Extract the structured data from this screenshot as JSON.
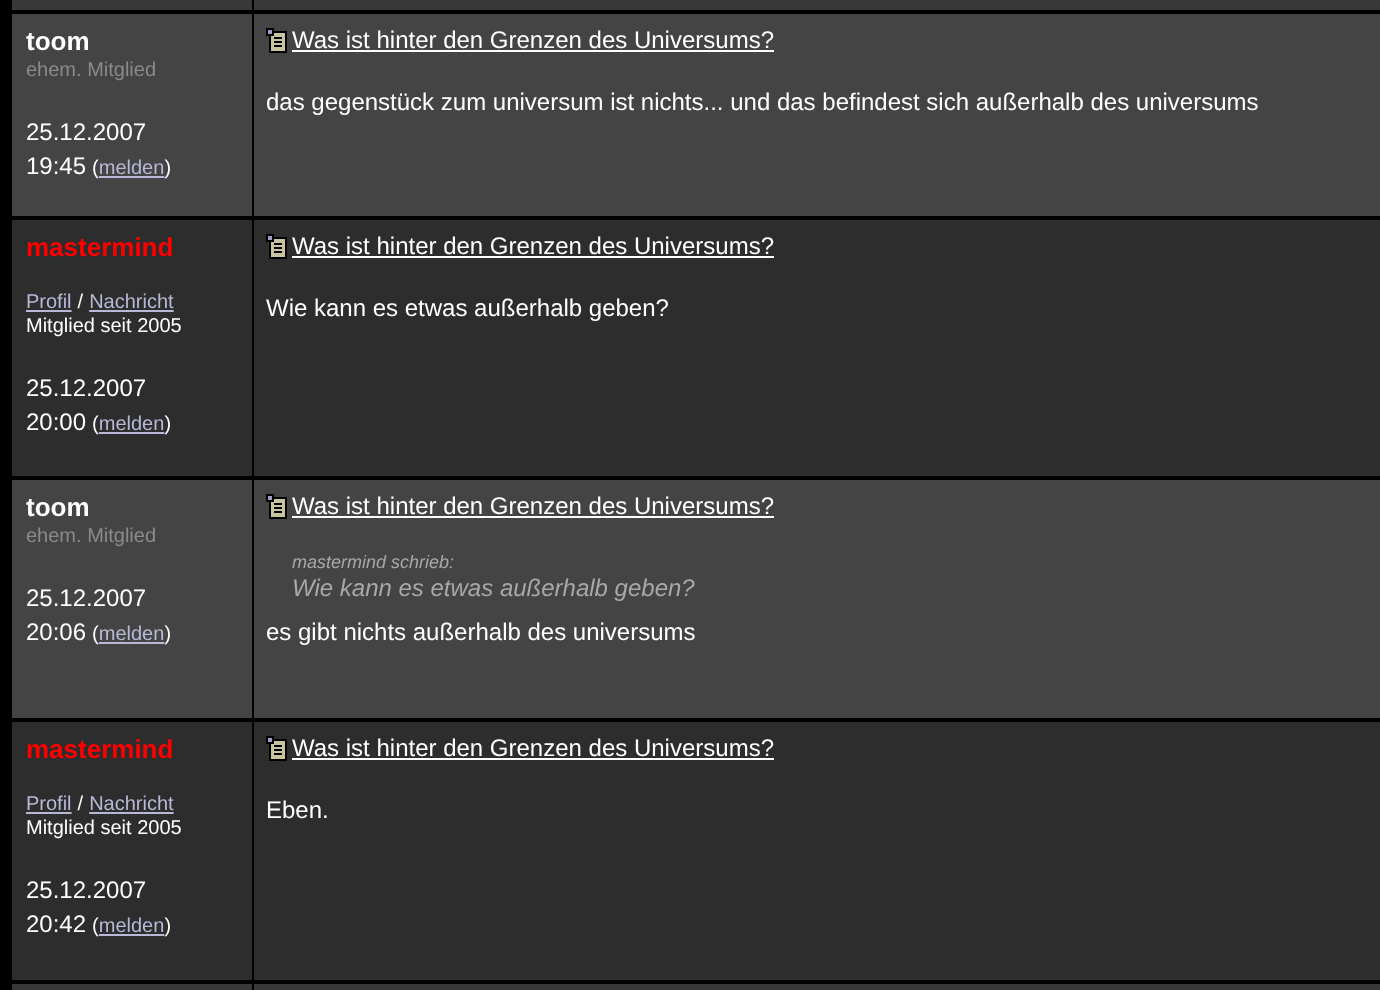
{
  "posts": [
    {
      "author": "toom",
      "kind": "former",
      "role": "ehem. Mitglied",
      "date": "25.12.2007",
      "time": "19:45",
      "report": [
        "(",
        "melden",
        ")"
      ],
      "subject": "Was ist hinter den Grenzen des Universums?",
      "body": "das gegenstück zum universum ist nichts... und das befindest sich außerhalb des universums"
    },
    {
      "author": "mastermind",
      "kind": "member",
      "links": [
        "Profil",
        "/",
        "Nachricht"
      ],
      "role": "Mitglied seit 2005",
      "date": "25.12.2007",
      "time": "20:00",
      "report": [
        "(",
        "melden",
        ")"
      ],
      "subject": "Was ist hinter den Grenzen des Universums?",
      "body": "Wie kann es etwas außerhalb geben?"
    },
    {
      "author": "toom",
      "kind": "former",
      "role": "ehem. Mitglied",
      "date": "25.12.2007",
      "time": "20:06",
      "report": [
        "(",
        "melden",
        ")"
      ],
      "subject": "Was ist hinter den Grenzen des Universums?",
      "quote": {
        "by": "mastermind schrieb:",
        "text": "Wie kann es etwas außerhalb geben?"
      },
      "body": "es gibt nichts außerhalb des universums"
    },
    {
      "author": "mastermind",
      "kind": "member",
      "links": [
        "Profil",
        "/",
        "Nachricht"
      ],
      "role": "Mitglied seit 2005",
      "date": "25.12.2007",
      "time": "20:42",
      "report": [
        "(",
        "melden",
        ")"
      ],
      "subject": "Was ist hinter den Grenzen des Universums?",
      "body": "Eben."
    }
  ]
}
